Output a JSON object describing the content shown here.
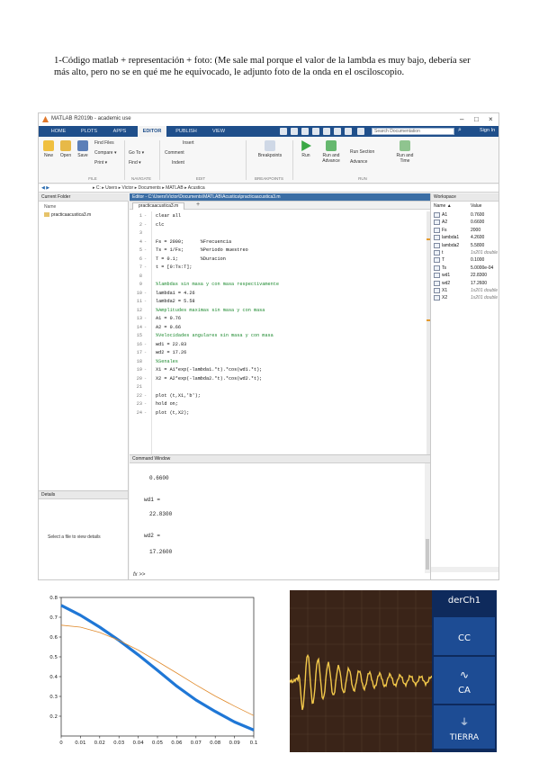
{
  "document": {
    "paragraph": "1-Código matlab + representación + foto: (Me sale mal porque el valor de la lambda es muy bajo, debería ser más alto, pero no se en qué me he equivocado, le adjunto foto de la onda en el osciloscopio."
  },
  "matlab": {
    "window_title": "MATLAB R2019b - academic use",
    "tabs": [
      "HOME",
      "PLOTS",
      "APPS",
      "EDITOR",
      "PUBLISH",
      "VIEW"
    ],
    "search_placeholder": "Search Documentation",
    "sign_in": "Sign In",
    "ribbon": {
      "new": "New",
      "open": "Open",
      "save": "Save",
      "find_files": "Find Files",
      "compare": "Compare ▾",
      "print": "Print ▾",
      "go_to": "Go To ▾",
      "find": "Find ▾",
      "insert": "Insert",
      "comment": "Comment",
      "indent": "Indent",
      "breakpoints": "Breakpoints",
      "run": "Run",
      "run_and_advance": "Run and Advance",
      "run_section": "Run Section",
      "advance": "Advance",
      "run_and_time": "Run and Time",
      "sec_file": "FILE",
      "sec_navigate": "NAVIGATE",
      "sec_edit": "EDIT",
      "sec_breakpoints": "BREAKPOINTS",
      "sec_run": "RUN"
    },
    "address": "▸ C: ▸ Users ▸ Victor ▸ Documents ▸ MATLAB ▸ Acustica",
    "current_folder": {
      "title": "Current Folder",
      "col_name": "Name",
      "file": "practicaacustica3.m"
    },
    "details": {
      "title": "Details",
      "hint": "Select a file to view details"
    },
    "editor": {
      "title": "Editor - C:\\Users\\Victor\\Documents\\MATLAB\\Acustica\\practicaacustica3.m",
      "tab": "practicaacustica3.m",
      "lines": [
        {
          "n": "1",
          "d": "-",
          "t": "clear all",
          "c": false
        },
        {
          "n": "2",
          "d": "-",
          "t": "clc",
          "c": false
        },
        {
          "n": "3",
          "d": "",
          "t": "",
          "c": false
        },
        {
          "n": "4",
          "d": "-",
          "t": "Fs = 2000;      %Frecuencia",
          "c": false
        },
        {
          "n": "5",
          "d": "-",
          "t": "Ts = 1/Fs;      %Periodo muestreo",
          "c": false
        },
        {
          "n": "6",
          "d": "-",
          "t": "T = 0.1;        %Duracion",
          "c": false
        },
        {
          "n": "7",
          "d": "-",
          "t": "t = [0:Ts:T];",
          "c": false
        },
        {
          "n": "8",
          "d": "",
          "t": "",
          "c": false
        },
        {
          "n": "9",
          "d": "",
          "t": "%lambdas sin masa y con masa respectivamente",
          "c": true
        },
        {
          "n": "10",
          "d": "-",
          "t": "lambda1 = 4.26",
          "c": false
        },
        {
          "n": "11",
          "d": "-",
          "t": "lambda2 = 5.58",
          "c": false
        },
        {
          "n": "12",
          "d": "",
          "t": "%Amplitudes maximas sin masa y con masa",
          "c": true
        },
        {
          "n": "13",
          "d": "-",
          "t": "A1 = 0.76",
          "c": false
        },
        {
          "n": "14",
          "d": "-",
          "t": "A2 = 0.66",
          "c": false
        },
        {
          "n": "15",
          "d": "",
          "t": "%Velocidades angulares sin masa y con masa",
          "c": true
        },
        {
          "n": "16",
          "d": "-",
          "t": "wd1 = 22.83",
          "c": false
        },
        {
          "n": "17",
          "d": "-",
          "t": "wd2 = 17.26",
          "c": false
        },
        {
          "n": "18",
          "d": "",
          "t": "%Senales",
          "c": true
        },
        {
          "n": "19",
          "d": "-",
          "t": "X1 = A1*exp(-lambda1.*t).*cos(wd1.*t);",
          "c": false
        },
        {
          "n": "20",
          "d": "-",
          "t": "X2 = A2*exp(-lambda2.*t).*cos(wd2.*t);",
          "c": false
        },
        {
          "n": "21",
          "d": "",
          "t": "",
          "c": false
        },
        {
          "n": "22",
          "d": "-",
          "t": "plot (t,X1,'b');",
          "c": false
        },
        {
          "n": "23",
          "d": "-",
          "t": "hold on;",
          "c": false
        },
        {
          "n": "24",
          "d": "-",
          "t": "plot (t,X2);",
          "c": false
        }
      ]
    },
    "command_window": {
      "title": "Command Window",
      "l1": "0.6600",
      "l2": "wd1 =",
      "l3": "22.8300",
      "l4": "wd2 =",
      "l5": "17.2600",
      "prompt": "fx >>"
    },
    "workspace": {
      "title": "Workspace",
      "col_name": "Name ▲",
      "col_value": "Value",
      "vars": [
        {
          "name": "A1",
          "value": "0.7600",
          "italic": false
        },
        {
          "name": "A2",
          "value": "0.6600",
          "italic": false
        },
        {
          "name": "Fs",
          "value": "2000",
          "italic": false
        },
        {
          "name": "lambda1",
          "value": "4.2600",
          "italic": false
        },
        {
          "name": "lambda2",
          "value": "5.5800",
          "italic": false
        },
        {
          "name": "t",
          "value": "1x201 double",
          "italic": true
        },
        {
          "name": "T",
          "value": "0.1000",
          "italic": false
        },
        {
          "name": "Ts",
          "value": "5.0000e-04",
          "italic": false
        },
        {
          "name": "wd1",
          "value": "22.8300",
          "italic": false
        },
        {
          "name": "wd2",
          "value": "17.2600",
          "italic": false
        },
        {
          "name": "X1",
          "value": "1x201 double",
          "italic": true
        },
        {
          "name": "X2",
          "value": "1x201 double",
          "italic": true
        }
      ]
    }
  },
  "chart_data": {
    "type": "line",
    "title": "",
    "xlabel": "",
    "ylabel": "",
    "xlim": [
      0,
      0.1
    ],
    "ylim": [
      0.1,
      0.8
    ],
    "x_ticks": [
      "0",
      "0.01",
      "0.02",
      "0.03",
      "0.04",
      "0.05",
      "0.06",
      "0.07",
      "0.08",
      "0.09",
      "0.1"
    ],
    "y_ticks": [
      "0.2",
      "0.3",
      "0.4",
      "0.5",
      "0.6",
      "0.7",
      "0.8"
    ],
    "grid": false,
    "series": [
      {
        "color": "#1f77d6",
        "width": "thick",
        "x": [
          0,
          0.01,
          0.02,
          0.03,
          0.04,
          0.05,
          0.06,
          0.07,
          0.08,
          0.09,
          0.1
        ],
        "values": [
          0.76,
          0.71,
          0.65,
          0.583,
          0.51,
          0.432,
          0.352,
          0.282,
          0.224,
          0.171,
          0.13
        ]
      },
      {
        "color": "#e08a2b",
        "width": "thin",
        "x": [
          0,
          0.01,
          0.02,
          0.03,
          0.04,
          0.05,
          0.06,
          0.07,
          0.08,
          0.09,
          0.1
        ],
        "values": [
          0.66,
          0.65,
          0.623,
          0.583,
          0.534,
          0.477,
          0.418,
          0.358,
          0.302,
          0.251,
          0.203
        ]
      }
    ]
  },
  "photo": {
    "label_top": "derCh1",
    "btn_cc": "CC",
    "btn_ca": "CA",
    "btn_tierra": "TIERRA",
    "btn_ca_icon": "ac-wave-icon",
    "btn_tierra_icon": "ground-icon"
  }
}
